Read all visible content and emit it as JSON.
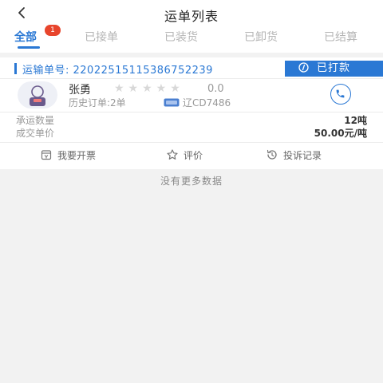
{
  "header": {
    "title": "运单列表",
    "back_icon": "chevron-left-icon"
  },
  "tabs": [
    {
      "label": "全部",
      "active": true,
      "badge": "1"
    },
    {
      "label": "已接单",
      "active": false
    },
    {
      "label": "已装货",
      "active": false
    },
    {
      "label": "已卸货",
      "active": false
    },
    {
      "label": "已结算",
      "active": false
    }
  ],
  "order": {
    "number_text": "运输单号: 2202251511538675223​9",
    "status_label": "已打款",
    "status_icon": "coin-icon",
    "driver": {
      "name": "张勇",
      "stars": "★★★★★",
      "rating_value": 0,
      "rating": "0.0",
      "history": "历史订单:2单",
      "plate": "辽CD7486",
      "plate_icon": "license-plate-icon",
      "call_icon": "phone-icon"
    },
    "fields": [
      {
        "label": "承运数量",
        "value": "12吨"
      },
      {
        "label": "成交单价",
        "value": "50.00元/吨"
      }
    ],
    "actions": [
      {
        "label": "我要开票",
        "icon": "invoice-icon"
      },
      {
        "label": "评价",
        "icon": "review-icon"
      },
      {
        "label": "投诉记录",
        "icon": "complaint-record-icon"
      }
    ]
  },
  "footer": {
    "no_more": "没有更多数据"
  },
  "colors": {
    "accent": "#2a78d4",
    "badge": "#e8452c",
    "background": "#f2f2f2"
  }
}
